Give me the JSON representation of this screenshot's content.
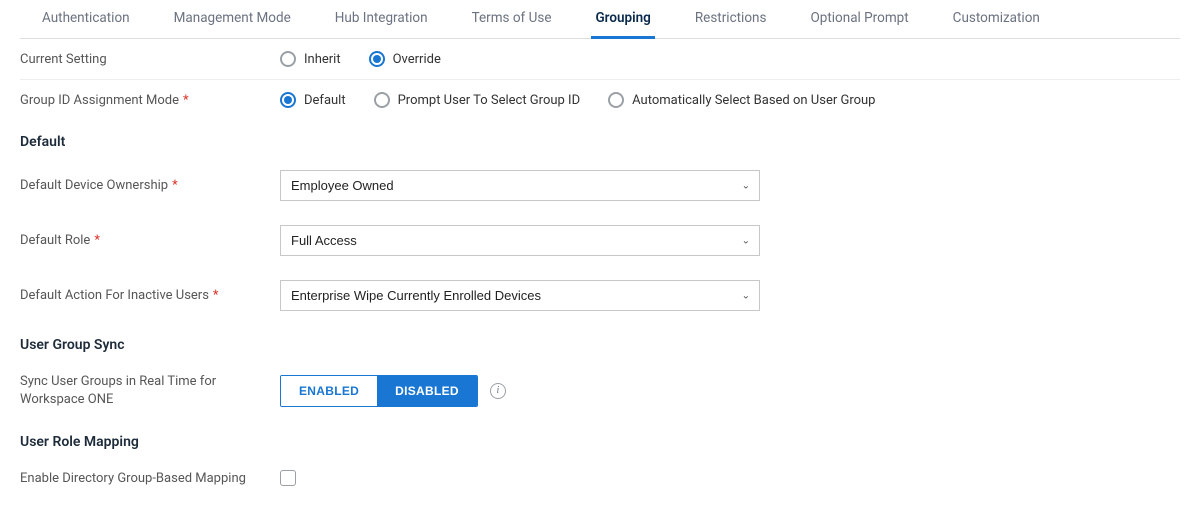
{
  "tabs": [
    {
      "label": "Authentication"
    },
    {
      "label": "Management Mode"
    },
    {
      "label": "Hub Integration"
    },
    {
      "label": "Terms of Use"
    },
    {
      "label": "Grouping"
    },
    {
      "label": "Restrictions"
    },
    {
      "label": "Optional Prompt"
    },
    {
      "label": "Customization"
    }
  ],
  "active_tab_index": 4,
  "current_setting": {
    "label": "Current Setting",
    "options": [
      {
        "label": "Inherit"
      },
      {
        "label": "Override"
      }
    ],
    "selected_index": 1
  },
  "group_id_mode": {
    "label": "Group ID Assignment Mode",
    "options": [
      {
        "label": "Default"
      },
      {
        "label": "Prompt User To Select Group ID"
      },
      {
        "label": "Automatically Select Based on User Group"
      }
    ],
    "selected_index": 0
  },
  "sections": {
    "default": {
      "heading": "Default",
      "device_ownership": {
        "label": "Default Device Ownership",
        "value": "Employee Owned"
      },
      "default_role": {
        "label": "Default Role",
        "value": "Full Access"
      },
      "inactive_action": {
        "label": "Default Action For Inactive Users",
        "value": "Enterprise Wipe Currently Enrolled Devices"
      }
    },
    "user_group_sync": {
      "heading": "User Group Sync",
      "sync_realtime": {
        "label": "Sync User Groups in Real Time for Workspace ONE",
        "options": {
          "enabled": "ENABLED",
          "disabled": "DISABLED"
        },
        "selected": "disabled"
      }
    },
    "user_role_mapping": {
      "heading": "User Role Mapping",
      "directory_mapping": {
        "label": "Enable Directory Group-Based Mapping",
        "checked": false
      }
    }
  }
}
